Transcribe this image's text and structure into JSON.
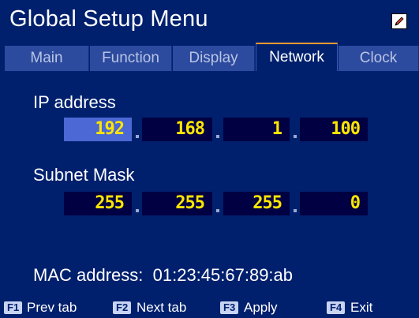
{
  "window": {
    "title": "Global Setup Menu",
    "edit_icon": "pencil-icon"
  },
  "tabs": [
    {
      "label": "Main",
      "active": false
    },
    {
      "label": "Function",
      "active": false
    },
    {
      "label": "Display",
      "active": false
    },
    {
      "label": "Network",
      "active": true
    },
    {
      "label": "Clock",
      "active": false
    }
  ],
  "ip": {
    "label": "IP address",
    "octets": [
      "192",
      "168",
      "1",
      "100"
    ],
    "separator": "."
  },
  "subnet": {
    "label": "Subnet Mask",
    "octets": [
      "255",
      "255",
      "255",
      "0"
    ],
    "separator": "."
  },
  "mac": {
    "label": "MAC address:",
    "value": "01:23:45:67:89:ab"
  },
  "function_keys": [
    {
      "key": "F1",
      "label": "Prev tab"
    },
    {
      "key": "F2",
      "label": "Next tab"
    },
    {
      "key": "F3",
      "label": "Apply"
    },
    {
      "key": "F4",
      "label": "Exit"
    }
  ],
  "colors": {
    "background": "#00206e",
    "inactive_tab": "#2c4a9e",
    "active_tab_accent": "#ff9a2e",
    "field_background": "#000042",
    "field_selected": "#4c68d4",
    "field_text": "#ffe600"
  }
}
